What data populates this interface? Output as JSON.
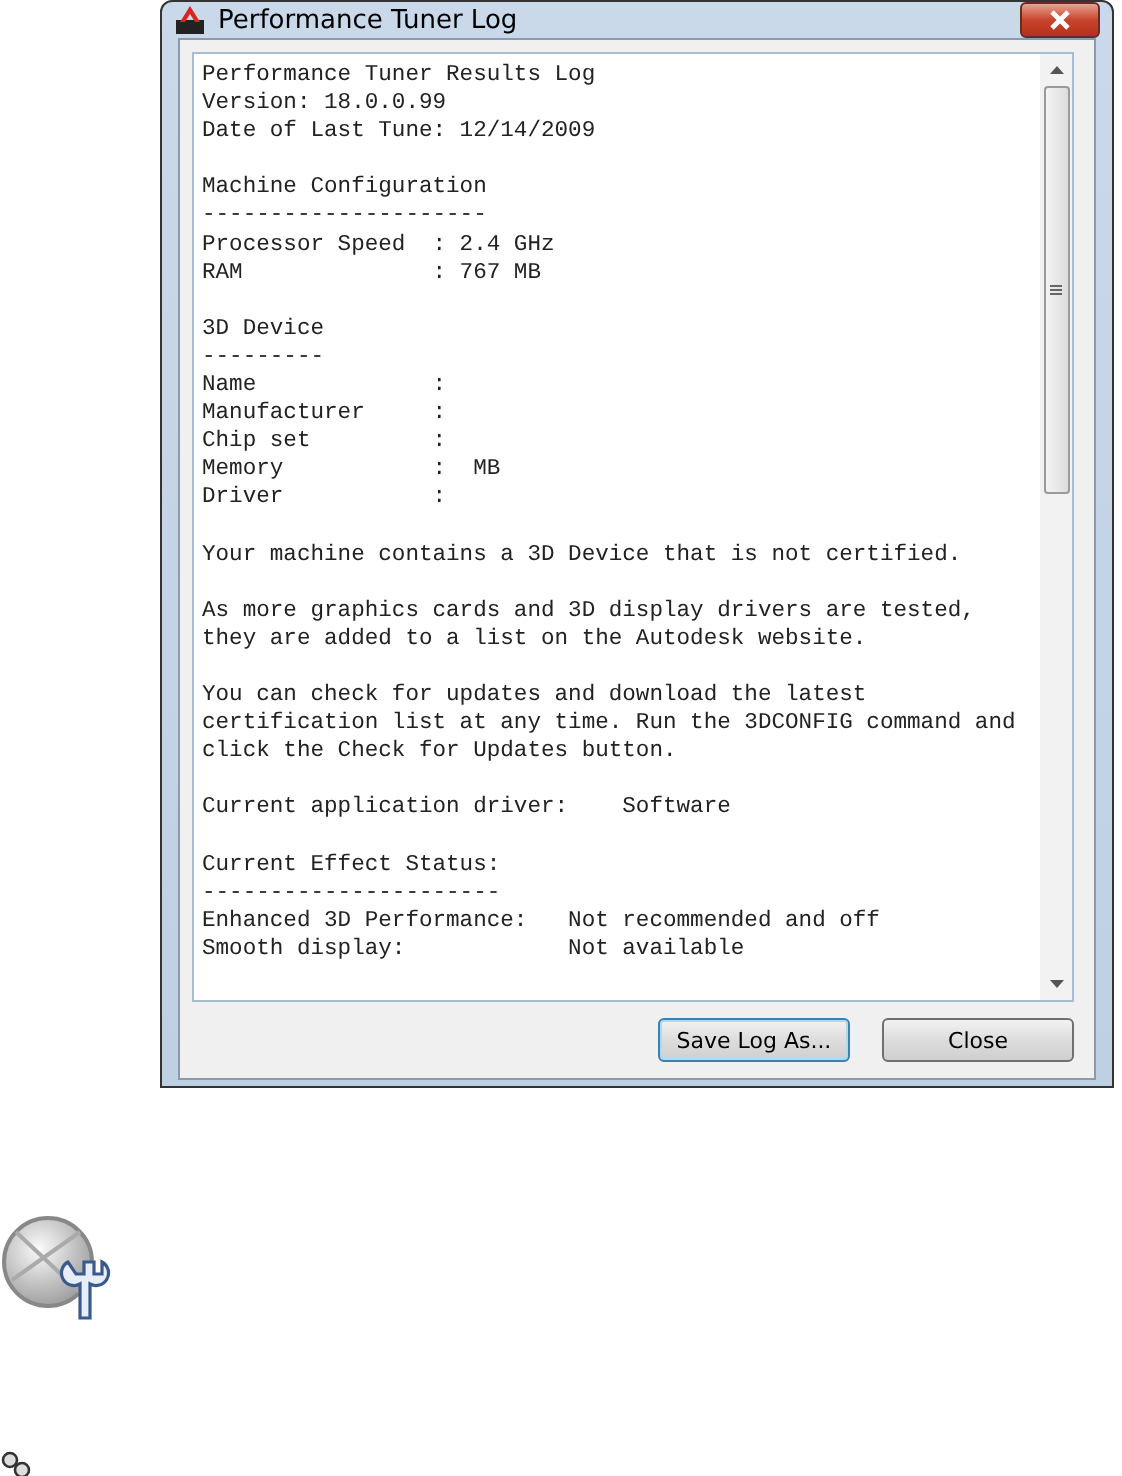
{
  "window": {
    "title": "Performance Tuner Log"
  },
  "log": [
    [
      "Performance Tuner Results Log",
      "Version: 18.0.0.99",
      "Date of Last Tune: 12/14/2009"
    ],
    [
      "Machine Configuration",
      "---------------------",
      "Processor Speed  : 2.4 GHz",
      "RAM              : 767 MB"
    ],
    [
      "3D Device",
      "---------",
      "Name             :",
      "Manufacturer     :",
      "Chip set         :",
      "Memory           :  MB",
      "Driver           :"
    ],
    [
      "Your machine contains a 3D Device that is not certified."
    ],
    [
      "As more graphics cards and 3D display drivers are tested,",
      "they are added to a list on the Autodesk website."
    ],
    [
      "You can check for updates and download the latest",
      "certification list at any time. Run the 3DCONFIG command and",
      "click the Check for Updates button."
    ],
    [
      "Current application driver:    Software"
    ],
    [
      "Current Effect Status:",
      "----------------------",
      "Enhanced 3D Performance:   Not recommended and off",
      "Smooth display:            Not available"
    ]
  ],
  "buttons": [
    {
      "label": "Save Log As...",
      "selected": true
    },
    {
      "label": "Close",
      "selected": false
    }
  ]
}
